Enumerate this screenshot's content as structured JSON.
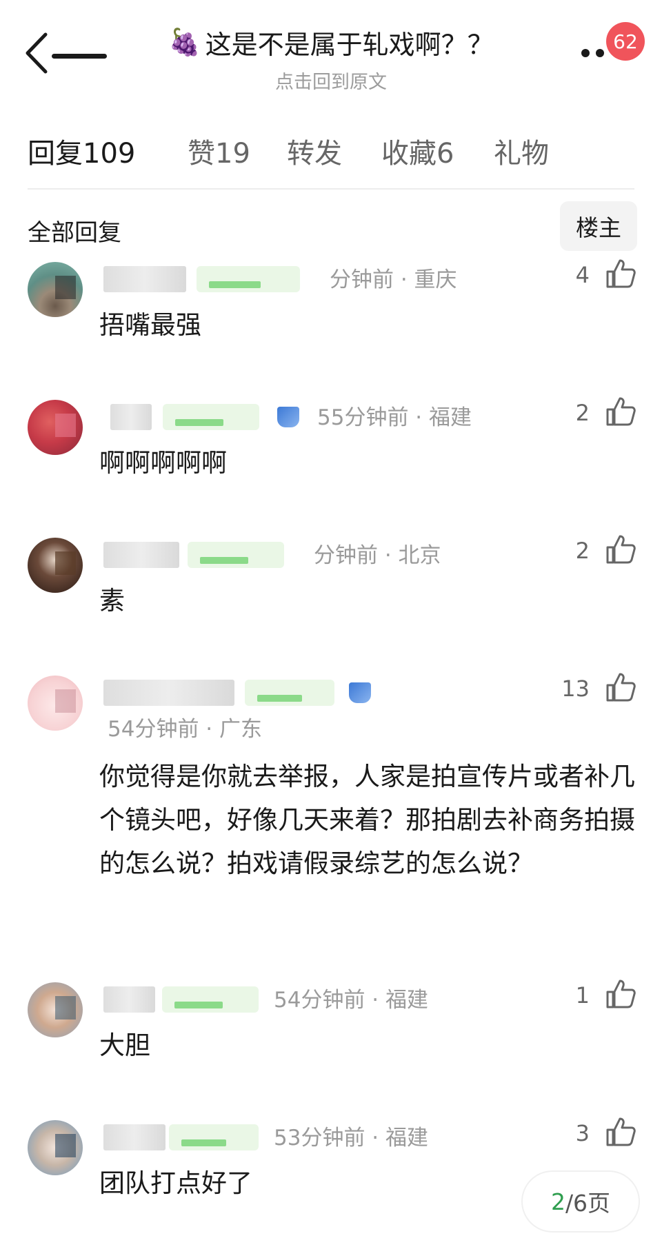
{
  "header": {
    "title_emoji": "🍇",
    "title": "这是不是属于轧戏啊？？",
    "subtitle": "点击回到原文",
    "badge_count": "62"
  },
  "tabs": [
    {
      "label": "回复",
      "count": "109"
    },
    {
      "label": "赞",
      "count": "19"
    },
    {
      "label": "转发",
      "count": ""
    },
    {
      "label": "收藏",
      "count": "6"
    },
    {
      "label": "礼物",
      "count": ""
    }
  ],
  "section": {
    "title": "全部回复",
    "op_button": "楼主"
  },
  "comments": [
    {
      "meta": "分钟前 · 重庆",
      "likes": "4",
      "content": "捂嘴最强"
    },
    {
      "meta": "55分钟前 · 福建",
      "likes": "2",
      "content": "啊啊啊啊啊"
    },
    {
      "meta": "分钟前 · 北京",
      "likes": "2",
      "content": "素"
    },
    {
      "meta": "54分钟前 · 广东",
      "likes": "13",
      "content": "你觉得是你就去举报，人家是拍宣传片或者补几个镜头吧，好像几天来着？那拍剧去补商务拍摄的怎么说？拍戏请假录综艺的怎么说？"
    },
    {
      "meta": "54分钟前 · 福建",
      "likes": "1",
      "content": "大胆"
    },
    {
      "meta": "53分钟前 · 福建",
      "likes": "3",
      "content": "团队打点好了"
    }
  ],
  "pager": {
    "current": "2",
    "total": "/6页"
  },
  "colors": {
    "badge": "#f0545b",
    "pager_current": "#2f9e4f",
    "meta": "#9a9a9a"
  }
}
